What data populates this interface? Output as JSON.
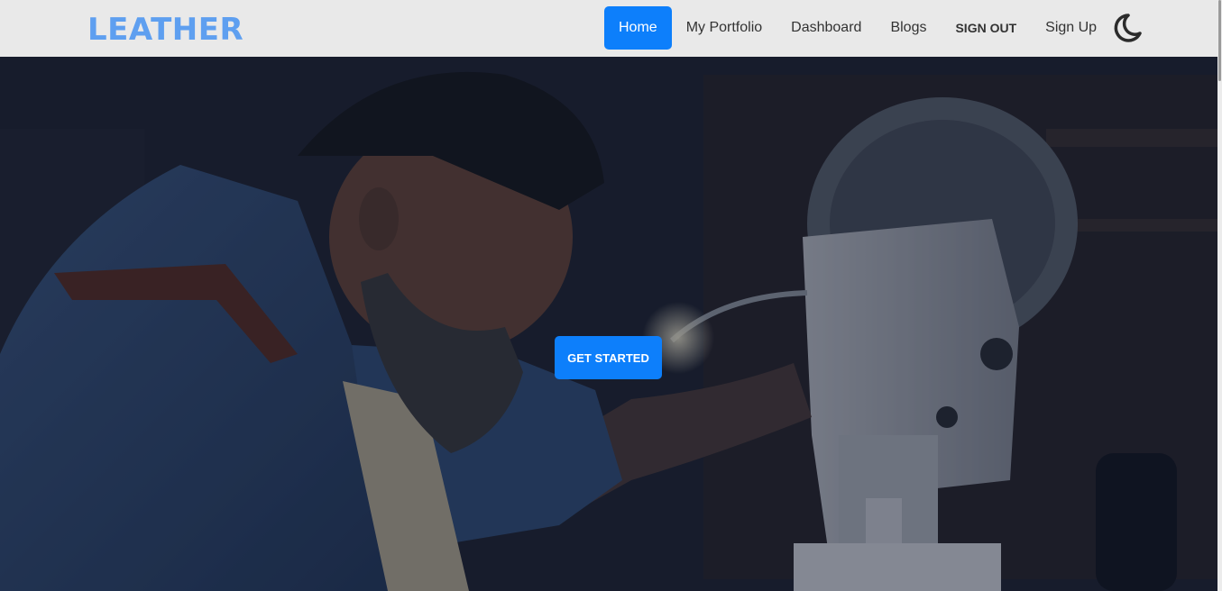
{
  "brand": {
    "name": "LEATHER",
    "color": "#5e9ff0"
  },
  "nav": {
    "items": [
      {
        "label": "Home",
        "active": true
      },
      {
        "label": "My Portfolio",
        "active": false
      },
      {
        "label": "Dashboard",
        "active": false
      },
      {
        "label": "Blogs",
        "active": false
      },
      {
        "label": "SIGN OUT",
        "active": false
      },
      {
        "label": "Sign Up",
        "active": false
      }
    ],
    "theme_toggle_icon": "moon-icon"
  },
  "hero": {
    "image": "man-at-sewing-machine-photo",
    "cta_label": "GET STARTED"
  },
  "colors": {
    "accent": "#0d7ffb",
    "navbar_bg": "#e9e9e9"
  }
}
